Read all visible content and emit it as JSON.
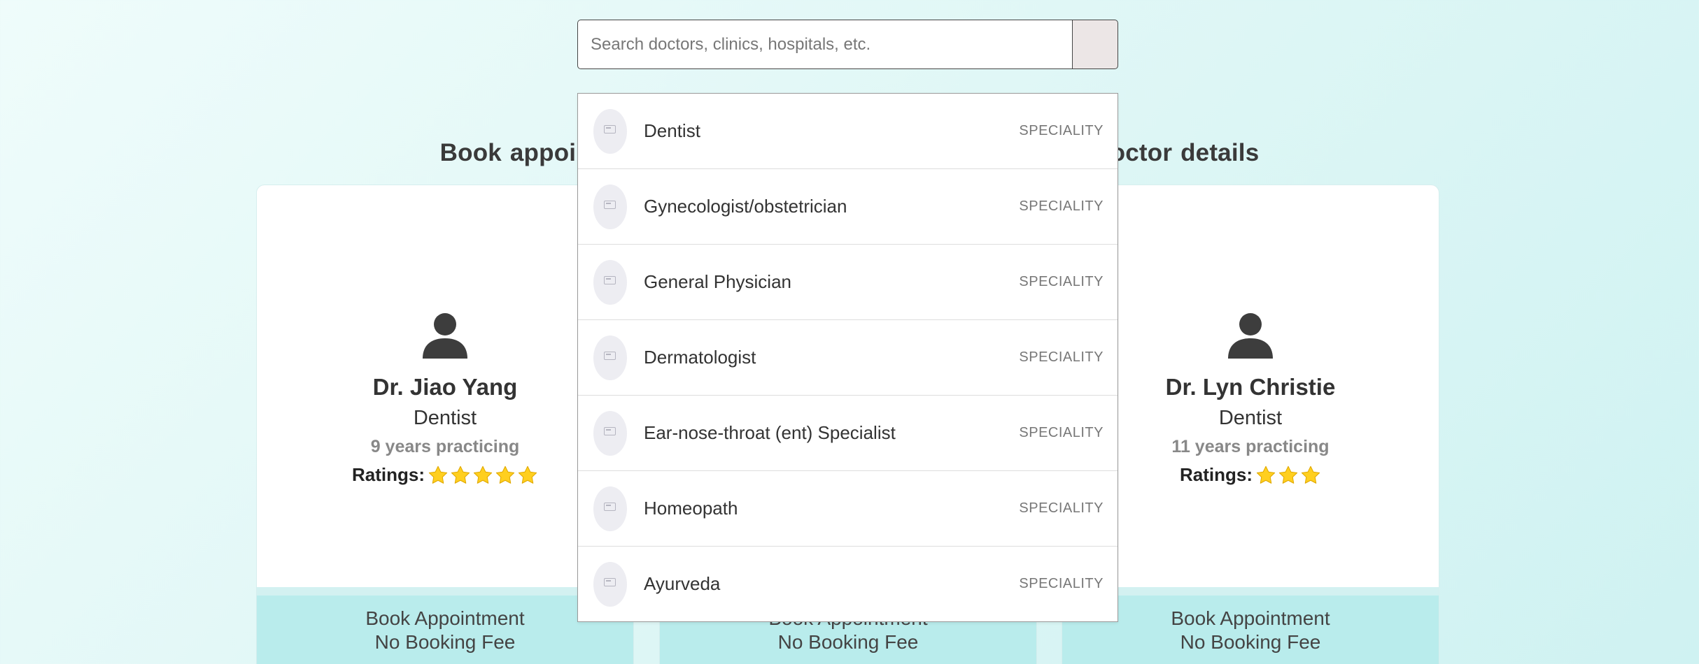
{
  "search": {
    "placeholder": "Search doctors, clinics, hospitals, etc."
  },
  "heading": "Book appointments with minimum wait-time & verified doctor details",
  "colors": {
    "background": "#e6f8f7",
    "book_button": "#b9ecec",
    "card": "#ffffff",
    "star": "#ffcf1f"
  },
  "doctors": [
    {
      "name": "Dr. Jiao Yang",
      "speciality": "Dentist",
      "experience": "9 years practicing",
      "ratings_label": "Ratings:",
      "stars": 5,
      "book_label": "Book Appointment",
      "fee_label": "No Booking Fee"
    },
    {
      "book_label": "Book Appointment",
      "fee_label": "No Booking Fee"
    },
    {
      "name": "Dr. Lyn Christie",
      "speciality": "Dentist",
      "experience": "11 years practicing",
      "ratings_label": "Ratings:",
      "stars": 3,
      "book_label": "Book Appointment",
      "fee_label": "No Booking Fee"
    }
  ],
  "dropdown": {
    "items": [
      {
        "label": "Dentist",
        "type": "SPECIALITY",
        "icon": "image-placeholder-icon"
      },
      {
        "label": "Gynecologist/obstetrician",
        "type": "SPECIALITY",
        "icon": "image-placeholder-icon"
      },
      {
        "label": "General Physician",
        "type": "SPECIALITY",
        "icon": "image-placeholder-icon"
      },
      {
        "label": "Dermatologist",
        "type": "SPECIALITY",
        "icon": "image-placeholder-icon"
      },
      {
        "label": "Ear-nose-throat (ent) Specialist",
        "type": "SPECIALITY",
        "icon": "image-placeholder-icon"
      },
      {
        "label": "Homeopath",
        "type": "SPECIALITY",
        "icon": "image-placeholder-icon"
      },
      {
        "label": "Ayurveda",
        "type": "SPECIALITY",
        "icon": "image-placeholder-icon"
      }
    ]
  }
}
